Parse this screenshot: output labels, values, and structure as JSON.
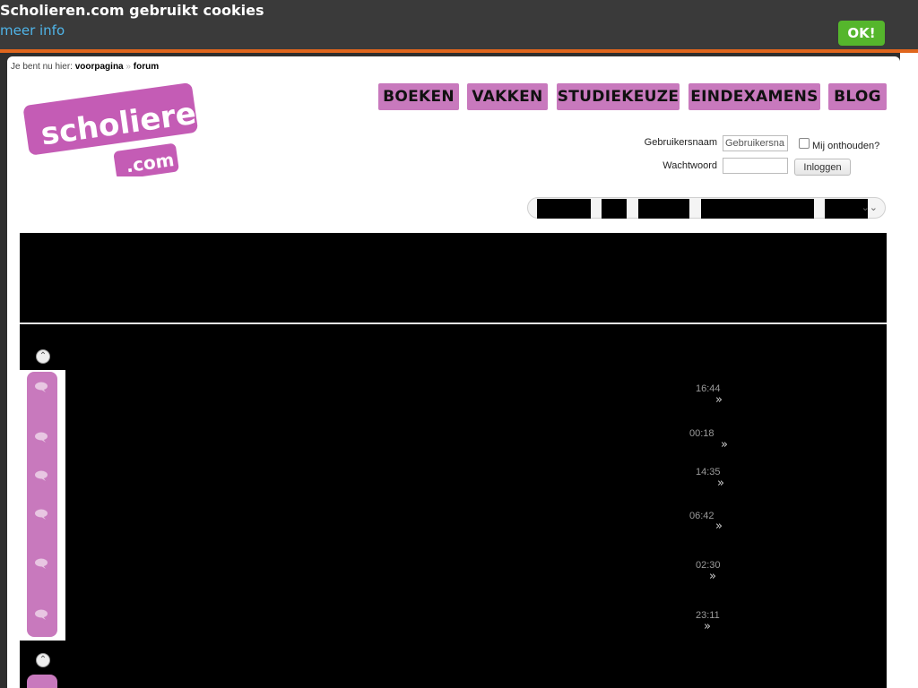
{
  "cookie": {
    "title": "Scholieren.com gebruikt cookies",
    "more_info": "meer info",
    "ok_label": "OK!"
  },
  "breadcrumb": {
    "prefix": "Je bent nu hier:",
    "home": "voorpagina",
    "separator": "»",
    "current": "forum"
  },
  "logo": {
    "word": "scholieren",
    "tld": ".com"
  },
  "nav": [
    "BOEKEN",
    "VAKKEN",
    "STUDIEKEUZE",
    "EINDEXAMENS",
    "BLOG"
  ],
  "login": {
    "username_label": "Gebruikersnaam",
    "username_value": "Gebruikersna",
    "remember_label": "Mij onthouden?",
    "password_label": "Wachtwoord",
    "submit_label": "Inloggen"
  },
  "subnav": {
    "chevron": "⌄⌄"
  },
  "threads": {
    "times": [
      "16:44",
      "00:18",
      "14:35",
      "06:42",
      "02:30",
      "23:11"
    ],
    "last_post_arrow": "»"
  },
  "colors": {
    "brand_pink": "#c879bd",
    "accent_orange": "#e0661d",
    "ok_green": "#55b62c",
    "link_blue": "#4fb4e8"
  },
  "icons": {
    "collapse": "collapse-icon",
    "thread": "speech-bubble-icon"
  }
}
